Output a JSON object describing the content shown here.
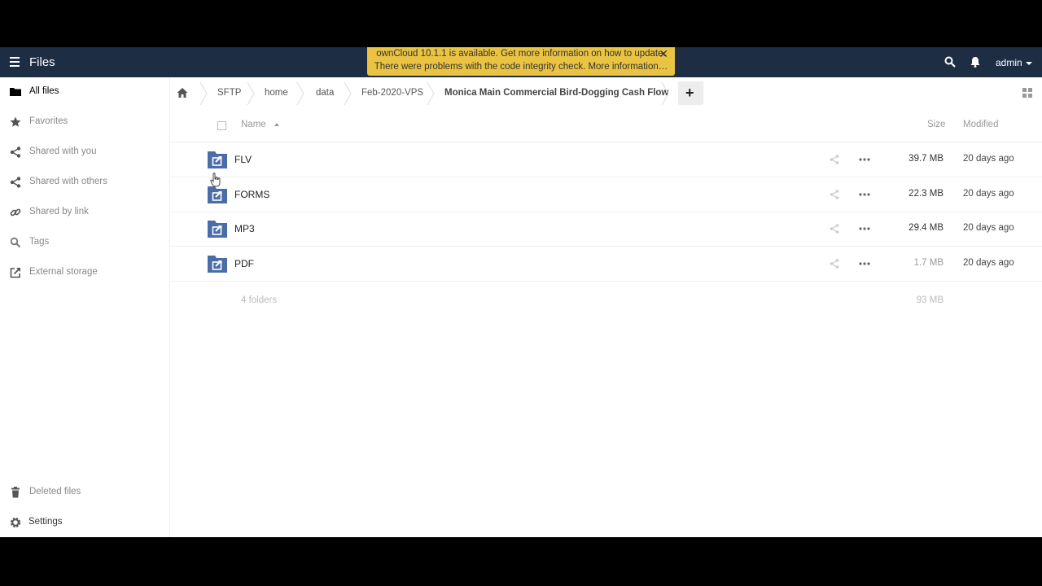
{
  "header": {
    "app_title": "Files",
    "user": "admin",
    "menu_icon": "hamburger-icon",
    "search_icon": "search-icon",
    "notifications_icon": "bell-icon",
    "bg_color": "#1d2d44"
  },
  "notification": {
    "line1": "ownCloud 10.1.1 is available. Get more information on how to update.",
    "line2": "There were problems with the code integrity check. More information…",
    "close": "✕",
    "color": "#e9c341"
  },
  "sidebar": {
    "items": [
      {
        "label": "All files",
        "icon": "folder-icon",
        "active": true
      },
      {
        "label": "Favorites",
        "icon": "star-icon"
      },
      {
        "label": "Shared with you",
        "icon": "share-icon"
      },
      {
        "label": "Shared with others",
        "icon": "share-icon"
      },
      {
        "label": "Shared by link",
        "icon": "link-icon"
      },
      {
        "label": "Tags",
        "icon": "search-icon"
      },
      {
        "label": "External storage",
        "icon": "external-link-icon"
      }
    ],
    "deleted_files": "Deleted files",
    "settings": "Settings"
  },
  "breadcrumb": {
    "home_icon": "home-icon",
    "items": [
      "SFTP",
      "home",
      "data",
      "Feb-2020-VPS",
      "Monica Main Commercial Bird-Dogging Cash Flow"
    ],
    "add_label": "+"
  },
  "table": {
    "columns": {
      "name": "Name",
      "size": "Size",
      "modified": "Modified"
    },
    "rows": [
      {
        "name": "FLV",
        "size": "39.7 MB",
        "modified": "20 days ago"
      },
      {
        "name": "FORMS",
        "size": "22.3 MB",
        "modified": "20 days ago"
      },
      {
        "name": "MP3",
        "size": "29.4 MB",
        "modified": "20 days ago"
      },
      {
        "name": "PDF",
        "size": "1.7 MB",
        "modified": "20 days ago"
      }
    ],
    "summary": {
      "count": "4 folders",
      "total": "93 MB"
    }
  },
  "colors": {
    "folder": "#4a6da7"
  }
}
